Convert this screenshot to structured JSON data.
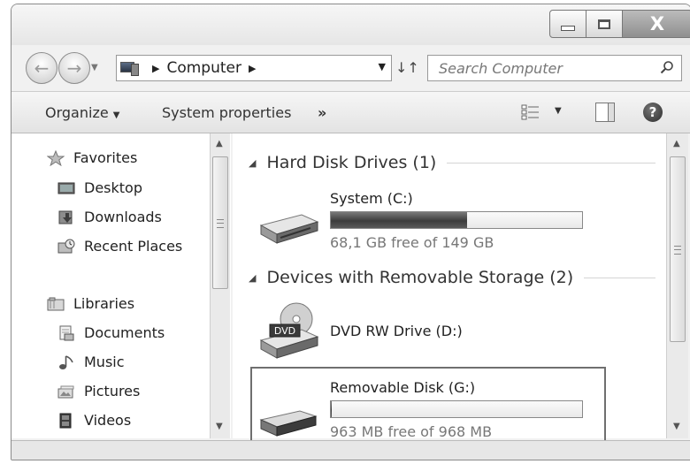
{
  "window": {
    "close_glyph": "X"
  },
  "address": {
    "segments": [
      "Computer"
    ],
    "search_placeholder": "Search Computer"
  },
  "toolbar": {
    "organize": "Organize",
    "system_properties": "System properties",
    "more": "»"
  },
  "navigation": {
    "favorites_header": "Favorites",
    "favorites": [
      {
        "label": "Desktop",
        "icon": "desktop-icon"
      },
      {
        "label": "Downloads",
        "icon": "downloads-icon"
      },
      {
        "label": "Recent Places",
        "icon": "recent-places-icon"
      }
    ],
    "libraries_header": "Libraries",
    "libraries": [
      {
        "label": "Documents",
        "icon": "documents-icon"
      },
      {
        "label": "Music",
        "icon": "music-icon"
      },
      {
        "label": "Pictures",
        "icon": "pictures-icon"
      },
      {
        "label": "Videos",
        "icon": "videos-icon"
      }
    ]
  },
  "groups": [
    {
      "title": "Hard Disk Drives (1)",
      "drives": [
        {
          "name": "System (C:)",
          "free_text": "68,1 GB free of 149 GB",
          "used_fraction": 0.543,
          "icon": "hard-disk-icon"
        }
      ]
    },
    {
      "title": "Devices with Removable Storage (2)",
      "drives": [
        {
          "name": "DVD RW Drive (D:)",
          "icon": "dvd-drive-icon",
          "icon_text": "DVD"
        },
        {
          "name": "Removable Disk (G:)",
          "free_text": "963 MB free of 968 MB",
          "used_fraction": 0.005,
          "icon": "removable-disk-icon",
          "selected": true
        }
      ]
    }
  ]
}
